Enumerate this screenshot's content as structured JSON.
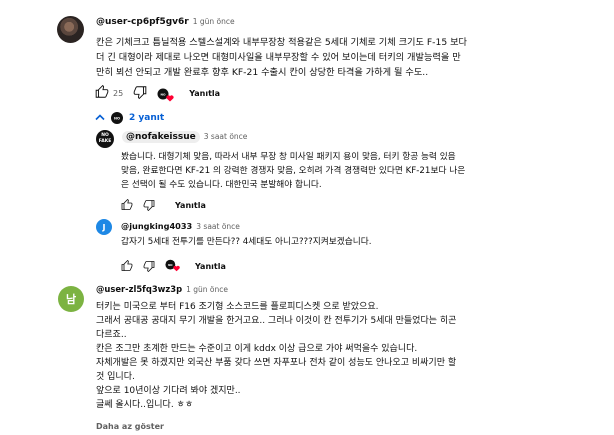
{
  "comments": [
    {
      "author": "@user-cp6pf5gv6r",
      "time": "1 gün önce",
      "lines": [
        "칸은 기체크고 틈닐적용 스텔스설계와 내부무장창 적용같은 5세대 기체로 기체 크기도 F-15 보다",
        "더 긴 대형이라 제대로 나오면 대형미사일을 내부무장할 수 있어 보이는데 터키의 개발능력을 만",
        "만히 뵈선 안되고 개발 완료후 향후 KF-21 수출시 칸이 상당한 타격을 가하게 될 수도.."
      ],
      "likes": "25",
      "reply_label": "Yanıtla"
    }
  ],
  "replies_toggle": "2 yanıt",
  "replies": [
    {
      "author": "@nofakeissue",
      "avatar_text": "NO FAKE ISS",
      "time": "3 saat önce",
      "lines": [
        "봤습니다. 대형기체 맞음, 따라서 내부 무장 창 미사일 패키지 용이 맞음, 터키 항공 능력 있음",
        "맞음, 완료한다면 KF-21 의 강력한 경쟁자 맞음, 오히려 가격 경쟁력만 있다면 KF-21보다 나은",
        "은 선택이 될 수도 있습니다. 대한민국 분발해야 합니다."
      ],
      "reply_label": "Yanıtla"
    },
    {
      "author": "@jungking4033",
      "avatar_letter": "J",
      "time": "3 saat önce",
      "lines": [
        "갑자기 5세대 전투기를 만든다?? 4세대도 아니고???지켜보겠습니다."
      ],
      "reply_label": "Yanıtla"
    }
  ],
  "comment2": {
    "author": "@user-zl5fq3wz3p",
    "avatar_letter": "남",
    "time": "1 gün önce",
    "lines": [
      "터키는 미국으로 부터 F16 조기형 소스코드를 플로피디스켓 으로 받았으요.",
      "그래서 공대공 공대지 무기 개발을 한거고요.. 그러나 이것이 칸 전투기가 5세대 만들었다는 히곤",
      "다르죠..",
      "칸은 조그만 초계한 만드는 수준이고 이게 kddx 이상 급으로 가야 써먹을수 있습니다.",
      "자체개발은 못 하겠지만 외국산 부품 갖다 쓰면 자푸포나 전차 같이 성능도 안나오고 비싸기만 할",
      "것 입니다.",
      "앞으로 10년이상 기다려 봐야 겠지만..",
      "글쎄 올시다..입니다. ㅎㅎ"
    ],
    "more": "Daha az göster"
  },
  "colors": {
    "link_blue": "#065fd4",
    "heart_red": "#ff0033",
    "avatar_green": "#7cb342",
    "avatar_blue": "#1e88e5",
    "muted": "#606060"
  },
  "icons": [
    "thumb-up-icon",
    "thumb-down-icon",
    "creator-heart-icon",
    "chevron-up-icon"
  ]
}
